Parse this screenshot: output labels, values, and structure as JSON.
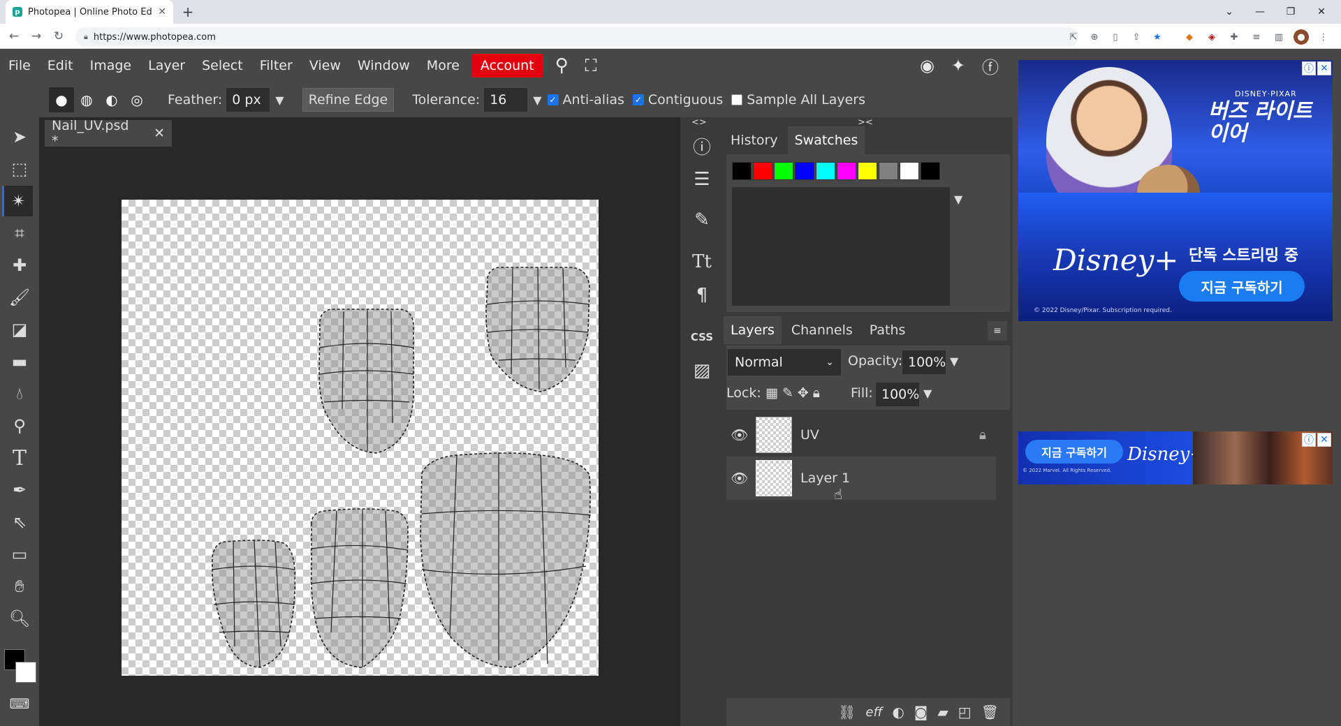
{
  "browser": {
    "tab_title": "Photopea | Online Photo Editor",
    "url": "https://www.photopea.com",
    "new_tab": "+",
    "close_tab": "✕"
  },
  "menu": [
    "File",
    "Edit",
    "Image",
    "Layer",
    "Select",
    "Filter",
    "View",
    "Window",
    "More"
  ],
  "account_label": "Account",
  "options": {
    "feather_label": "Feather:",
    "feather_value": "0 px",
    "refine_edge": "Refine Edge",
    "tolerance_label": "Tolerance:",
    "tolerance_value": "16",
    "anti_alias": "Anti-alias",
    "contiguous": "Contiguous",
    "sample_all": "Sample All Layers"
  },
  "document": {
    "tab_label": "Nail_UV.psd *"
  },
  "panels": {
    "top_tabs": [
      "History",
      "Swatches"
    ],
    "top_selected": "Swatches",
    "swatch_colors": [
      "#000000",
      "#ff0000",
      "#00ff00",
      "#0000ff",
      "#00ffff",
      "#ff00ff",
      "#ffff00",
      "#808080",
      "#ffffff",
      "#000000"
    ],
    "layer_tabs": [
      "Layers",
      "Channels",
      "Paths"
    ],
    "blend_mode": "Normal",
    "opacity_label": "Opacity:",
    "opacity_value": "100%",
    "lock_label": "Lock:",
    "fill_label": "Fill:",
    "fill_value": "100%",
    "layers": [
      {
        "name": "UV",
        "locked": true,
        "selected": false
      },
      {
        "name": "Layer 1",
        "locked": false,
        "selected": true
      }
    ],
    "bottom_icons": [
      "link-icon",
      "effects-icon",
      "adjustment-icon",
      "mask-icon",
      "folder-icon",
      "new-layer-icon",
      "trash-icon"
    ],
    "effects_text": "eff"
  },
  "sidebar_css": "CSS",
  "ads": {
    "ad1_brand": "DISNEY·PIXAR",
    "ad1_title": "버즈 라이트이어",
    "ad1_logo": "Disney+",
    "ad1_headline": "단독 스트리밍 중",
    "ad1_cta": "지금 구독하기",
    "ad1_fine": "© 2022 Disney/Pixar. Subscription required.",
    "ad2_cta": "지금 구독하기",
    "ad2_logo": "Disney+",
    "ad2_fine": "© 2022 Marvel. All Rights Reserved."
  }
}
